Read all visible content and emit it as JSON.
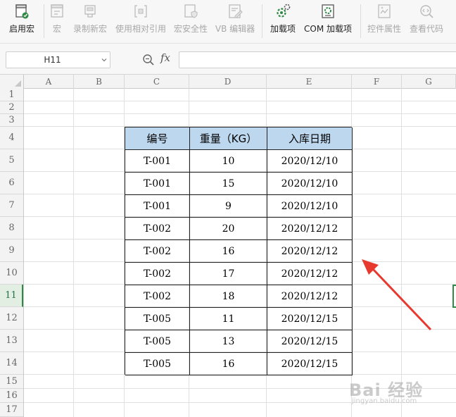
{
  "ribbon": {
    "items": [
      {
        "label": "启用宏",
        "icon": "macro-enable-icon",
        "enabled": true
      },
      {
        "label": "宏",
        "icon": "macro-icon",
        "enabled": false
      },
      {
        "label": "录制新宏",
        "icon": "record-macro-icon",
        "enabled": false
      },
      {
        "label": "使用相对引用",
        "icon": "relative-reference-icon",
        "enabled": false
      },
      {
        "label": "宏安全性",
        "icon": "macro-security-icon",
        "enabled": false
      },
      {
        "label": "VB 编辑器",
        "icon": "vb-editor-icon",
        "enabled": false
      },
      {
        "label": "加载项",
        "icon": "add-ins-icon",
        "enabled": true
      },
      {
        "label": "COM 加载项",
        "icon": "com-add-ins-icon",
        "enabled": true
      },
      {
        "label": "控件属性",
        "icon": "control-properties-icon",
        "enabled": false
      },
      {
        "label": "查看代码",
        "icon": "view-code-icon",
        "enabled": false
      }
    ]
  },
  "formula_bar": {
    "name_box": "H11",
    "fx_label": "fx",
    "formula_value": ""
  },
  "columns": [
    "A",
    "B",
    "C",
    "D",
    "E",
    "F",
    "G"
  ],
  "rows": [
    "1",
    "2",
    "3",
    "4",
    "5",
    "6",
    "7",
    "8",
    "9",
    "10",
    "11",
    "12",
    "13",
    "14",
    "15",
    "16",
    "17"
  ],
  "selected_row": "11",
  "table": {
    "headers": [
      "编号",
      "重量（KG）",
      "入库日期"
    ],
    "rows": [
      [
        "T-001",
        "10",
        "2020/12/10"
      ],
      [
        "T-001",
        "15",
        "2020/12/10"
      ],
      [
        "T-001",
        "9",
        "2020/12/10"
      ],
      [
        "T-002",
        "20",
        "2020/12/12"
      ],
      [
        "T-002",
        "16",
        "2020/12/12"
      ],
      [
        "T-002",
        "17",
        "2020/12/12"
      ],
      [
        "T-002",
        "18",
        "2020/12/12"
      ],
      [
        "T-005",
        "11",
        "2020/12/15"
      ],
      [
        "T-005",
        "13",
        "2020/12/15"
      ],
      [
        "T-005",
        "16",
        "2020/12/15"
      ]
    ]
  },
  "colors": {
    "header_fill": "#bdd7ee",
    "arrow": "#e8392f",
    "selection": "#2f8a46"
  },
  "watermark": {
    "title": "Bai 经验",
    "subtitle": "jingyan.baidu.com"
  }
}
